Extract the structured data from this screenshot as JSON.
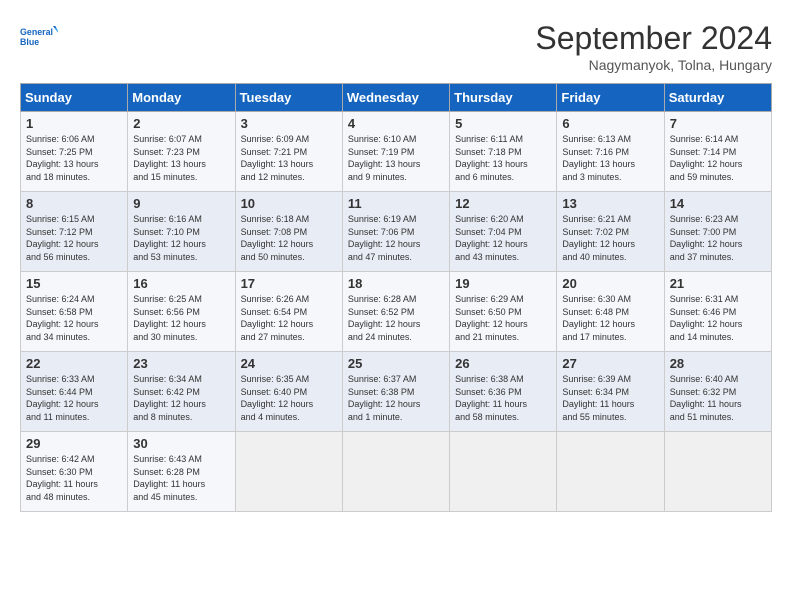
{
  "logo": {
    "line1": "General",
    "line2": "Blue"
  },
  "title": "September 2024",
  "subtitle": "Nagymanyok, Tolna, Hungary",
  "headers": [
    "Sunday",
    "Monday",
    "Tuesday",
    "Wednesday",
    "Thursday",
    "Friday",
    "Saturday"
  ],
  "weeks": [
    [
      {
        "day": "1",
        "info": "Sunrise: 6:06 AM\nSunset: 7:25 PM\nDaylight: 13 hours\nand 18 minutes."
      },
      {
        "day": "2",
        "info": "Sunrise: 6:07 AM\nSunset: 7:23 PM\nDaylight: 13 hours\nand 15 minutes."
      },
      {
        "day": "3",
        "info": "Sunrise: 6:09 AM\nSunset: 7:21 PM\nDaylight: 13 hours\nand 12 minutes."
      },
      {
        "day": "4",
        "info": "Sunrise: 6:10 AM\nSunset: 7:19 PM\nDaylight: 13 hours\nand 9 minutes."
      },
      {
        "day": "5",
        "info": "Sunrise: 6:11 AM\nSunset: 7:18 PM\nDaylight: 13 hours\nand 6 minutes."
      },
      {
        "day": "6",
        "info": "Sunrise: 6:13 AM\nSunset: 7:16 PM\nDaylight: 13 hours\nand 3 minutes."
      },
      {
        "day": "7",
        "info": "Sunrise: 6:14 AM\nSunset: 7:14 PM\nDaylight: 12 hours\nand 59 minutes."
      }
    ],
    [
      {
        "day": "8",
        "info": "Sunrise: 6:15 AM\nSunset: 7:12 PM\nDaylight: 12 hours\nand 56 minutes."
      },
      {
        "day": "9",
        "info": "Sunrise: 6:16 AM\nSunset: 7:10 PM\nDaylight: 12 hours\nand 53 minutes."
      },
      {
        "day": "10",
        "info": "Sunrise: 6:18 AM\nSunset: 7:08 PM\nDaylight: 12 hours\nand 50 minutes."
      },
      {
        "day": "11",
        "info": "Sunrise: 6:19 AM\nSunset: 7:06 PM\nDaylight: 12 hours\nand 47 minutes."
      },
      {
        "day": "12",
        "info": "Sunrise: 6:20 AM\nSunset: 7:04 PM\nDaylight: 12 hours\nand 43 minutes."
      },
      {
        "day": "13",
        "info": "Sunrise: 6:21 AM\nSunset: 7:02 PM\nDaylight: 12 hours\nand 40 minutes."
      },
      {
        "day": "14",
        "info": "Sunrise: 6:23 AM\nSunset: 7:00 PM\nDaylight: 12 hours\nand 37 minutes."
      }
    ],
    [
      {
        "day": "15",
        "info": "Sunrise: 6:24 AM\nSunset: 6:58 PM\nDaylight: 12 hours\nand 34 minutes."
      },
      {
        "day": "16",
        "info": "Sunrise: 6:25 AM\nSunset: 6:56 PM\nDaylight: 12 hours\nand 30 minutes."
      },
      {
        "day": "17",
        "info": "Sunrise: 6:26 AM\nSunset: 6:54 PM\nDaylight: 12 hours\nand 27 minutes."
      },
      {
        "day": "18",
        "info": "Sunrise: 6:28 AM\nSunset: 6:52 PM\nDaylight: 12 hours\nand 24 minutes."
      },
      {
        "day": "19",
        "info": "Sunrise: 6:29 AM\nSunset: 6:50 PM\nDaylight: 12 hours\nand 21 minutes."
      },
      {
        "day": "20",
        "info": "Sunrise: 6:30 AM\nSunset: 6:48 PM\nDaylight: 12 hours\nand 17 minutes."
      },
      {
        "day": "21",
        "info": "Sunrise: 6:31 AM\nSunset: 6:46 PM\nDaylight: 12 hours\nand 14 minutes."
      }
    ],
    [
      {
        "day": "22",
        "info": "Sunrise: 6:33 AM\nSunset: 6:44 PM\nDaylight: 12 hours\nand 11 minutes."
      },
      {
        "day": "23",
        "info": "Sunrise: 6:34 AM\nSunset: 6:42 PM\nDaylight: 12 hours\nand 8 minutes."
      },
      {
        "day": "24",
        "info": "Sunrise: 6:35 AM\nSunset: 6:40 PM\nDaylight: 12 hours\nand 4 minutes."
      },
      {
        "day": "25",
        "info": "Sunrise: 6:37 AM\nSunset: 6:38 PM\nDaylight: 12 hours\nand 1 minute."
      },
      {
        "day": "26",
        "info": "Sunrise: 6:38 AM\nSunset: 6:36 PM\nDaylight: 11 hours\nand 58 minutes."
      },
      {
        "day": "27",
        "info": "Sunrise: 6:39 AM\nSunset: 6:34 PM\nDaylight: 11 hours\nand 55 minutes."
      },
      {
        "day": "28",
        "info": "Sunrise: 6:40 AM\nSunset: 6:32 PM\nDaylight: 11 hours\nand 51 minutes."
      }
    ],
    [
      {
        "day": "29",
        "info": "Sunrise: 6:42 AM\nSunset: 6:30 PM\nDaylight: 11 hours\nand 48 minutes."
      },
      {
        "day": "30",
        "info": "Sunrise: 6:43 AM\nSunset: 6:28 PM\nDaylight: 11 hours\nand 45 minutes."
      },
      {
        "day": "",
        "info": ""
      },
      {
        "day": "",
        "info": ""
      },
      {
        "day": "",
        "info": ""
      },
      {
        "day": "",
        "info": ""
      },
      {
        "day": "",
        "info": ""
      }
    ]
  ]
}
